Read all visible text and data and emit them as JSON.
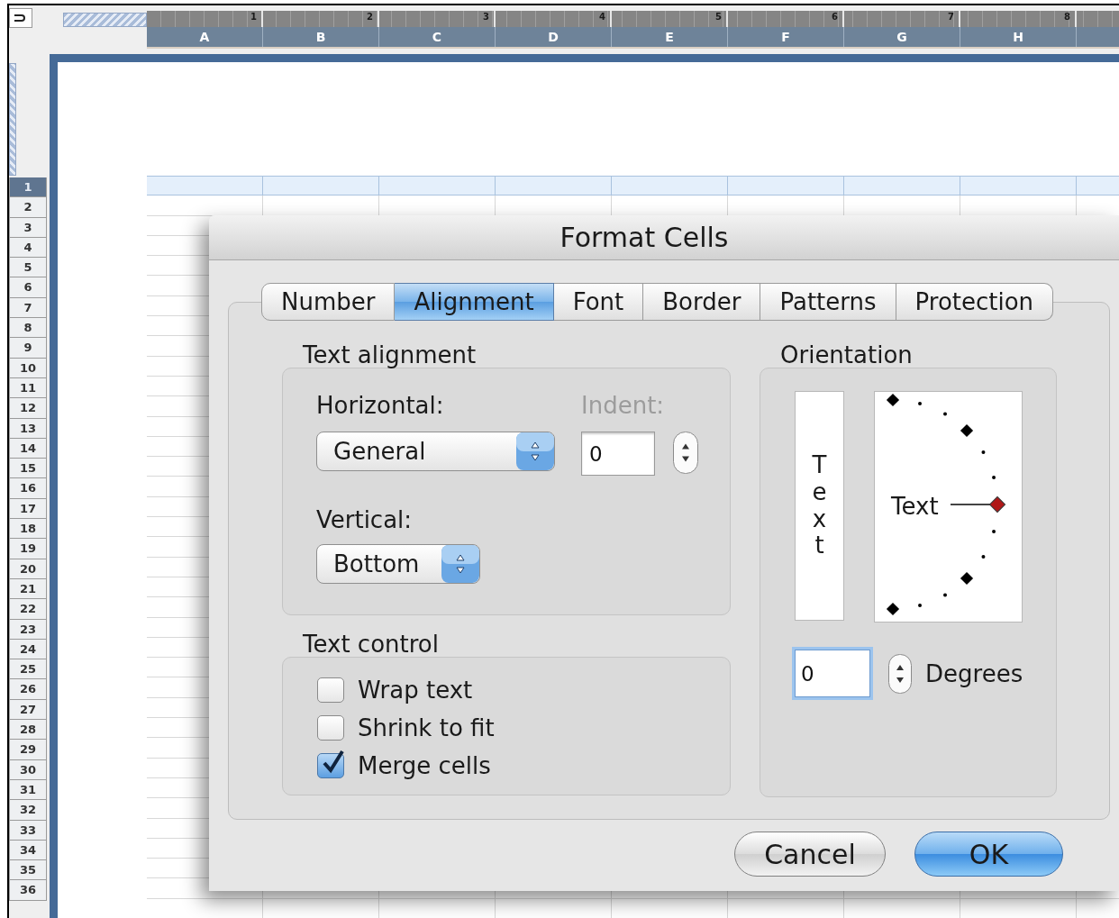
{
  "sheet": {
    "columns": [
      {
        "label": "A",
        "ruler": "1"
      },
      {
        "label": "B",
        "ruler": "2"
      },
      {
        "label": "C",
        "ruler": "3"
      },
      {
        "label": "D",
        "ruler": "4"
      },
      {
        "label": "E",
        "ruler": "5"
      },
      {
        "label": "F",
        "ruler": "6"
      },
      {
        "label": "G",
        "ruler": "7"
      },
      {
        "label": "H",
        "ruler": "8"
      }
    ],
    "rows": [
      {
        "label": "1",
        "selected": true
      },
      {
        "label": "2",
        "selected": false
      },
      {
        "label": "3",
        "selected": false
      },
      {
        "label": "4",
        "selected": false
      },
      {
        "label": "5",
        "selected": false
      },
      {
        "label": "6",
        "selected": false
      },
      {
        "label": "7",
        "selected": false
      },
      {
        "label": "8",
        "selected": false
      },
      {
        "label": "9",
        "selected": false
      },
      {
        "label": "10",
        "selected": false
      },
      {
        "label": "11",
        "selected": false
      },
      {
        "label": "12",
        "selected": false
      },
      {
        "label": "13",
        "selected": false
      },
      {
        "label": "14",
        "selected": false
      },
      {
        "label": "15",
        "selected": false
      },
      {
        "label": "16",
        "selected": false
      },
      {
        "label": "17",
        "selected": false
      },
      {
        "label": "18",
        "selected": false
      },
      {
        "label": "19",
        "selected": false
      },
      {
        "label": "20",
        "selected": false
      },
      {
        "label": "21",
        "selected": false
      },
      {
        "label": "22",
        "selected": false
      },
      {
        "label": "23",
        "selected": false
      },
      {
        "label": "24",
        "selected": false
      },
      {
        "label": "25",
        "selected": false
      },
      {
        "label": "26",
        "selected": false
      },
      {
        "label": "27",
        "selected": false
      },
      {
        "label": "28",
        "selected": false
      },
      {
        "label": "29",
        "selected": false
      },
      {
        "label": "30",
        "selected": false
      },
      {
        "label": "31",
        "selected": false
      },
      {
        "label": "32",
        "selected": false
      },
      {
        "label": "33",
        "selected": false
      },
      {
        "label": "34",
        "selected": false
      },
      {
        "label": "35",
        "selected": false
      },
      {
        "label": "36",
        "selected": false
      }
    ]
  },
  "dialog": {
    "title": "Format Cells",
    "tabs": [
      {
        "label": "Number",
        "selected": false
      },
      {
        "label": "Alignment",
        "selected": true
      },
      {
        "label": "Font",
        "selected": false
      },
      {
        "label": "Border",
        "selected": false
      },
      {
        "label": "Patterns",
        "selected": false
      },
      {
        "label": "Protection",
        "selected": false
      }
    ],
    "text_alignment": {
      "title": "Text alignment",
      "horizontal": {
        "label": "Horizontal:",
        "value": "General"
      },
      "indent": {
        "label": "Indent:",
        "value": "0",
        "disabled": true
      },
      "vertical": {
        "label": "Vertical:",
        "value": "Bottom"
      }
    },
    "text_control": {
      "title": "Text control",
      "options": [
        {
          "label": "Wrap text",
          "checked": false
        },
        {
          "label": "Shrink to fit",
          "checked": false
        },
        {
          "label": "Merge cells",
          "checked": true
        }
      ]
    },
    "orientation": {
      "title": "Orientation",
      "vertical_text": "Text",
      "dial_text": "Text",
      "degrees": {
        "value": "0",
        "label": "Degrees"
      }
    },
    "buttons": [
      {
        "label": "Cancel",
        "default": false
      },
      {
        "label": "OK",
        "default": true
      }
    ]
  }
}
